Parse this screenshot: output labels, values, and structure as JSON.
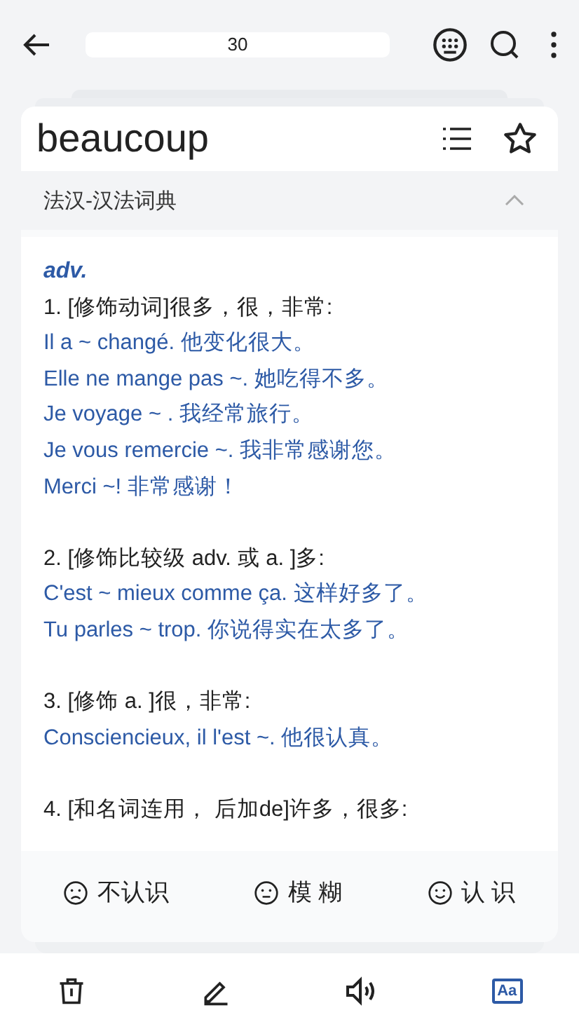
{
  "top_bar": {
    "search": {
      "value": "30"
    }
  },
  "card": {
    "word": "beaucoup",
    "dictionary": {
      "name": "法汉-汉法词典",
      "expanded": true
    },
    "definition": {
      "pos": "adv.",
      "senses": [
        {
          "text": "1. [修饰动词]很多，很，非常:",
          "examples": [
            "Il a ~ changé. 他变化很大。",
            "Elle ne mange pas ~. 她吃得不多。",
            "Je voyage ~ . 我经常旅行。",
            "Je vous remercie ~. 我非常感谢您。",
            "Merci ~! 非常感谢！"
          ]
        },
        {
          "text": "2. [修饰比较级 adv. 或 a. ]多:",
          "examples": [
            "C'est ~ mieux comme ça. 这样好多了。",
            "Tu parles ~ trop. 你说得实在太多了。"
          ]
        },
        {
          "text": "3. [修饰 a. ]很，非常:",
          "examples": [
            "Consciencieux, il l'est ~. 他很认真。"
          ]
        },
        {
          "text": "4. [和名词连用， 后加de]许多，很多:"
        }
      ]
    },
    "ratings": [
      {
        "kind": "sad",
        "label": "不认识"
      },
      {
        "kind": "neutral",
        "label": "模 糊"
      },
      {
        "kind": "happy",
        "label": "认 识"
      }
    ]
  },
  "bottom_bar": [
    {
      "kind": "delete",
      "selected": false
    },
    {
      "kind": "edit",
      "selected": false
    },
    {
      "kind": "speaker",
      "selected": false
    },
    {
      "kind": "font",
      "label": "Aa",
      "selected": true
    }
  ]
}
